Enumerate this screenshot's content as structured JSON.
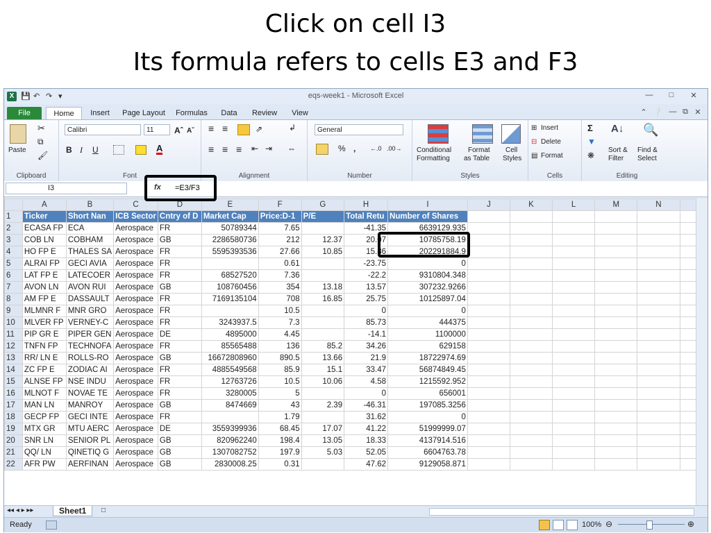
{
  "slide": {
    "title_line1": "Click on cell I3",
    "title_line2": "Its formula refers to cells E3 and F3"
  },
  "window": {
    "title": "eqs-week1 - Microsoft Excel"
  },
  "tabs": [
    "File",
    "Home",
    "Insert",
    "Page Layout",
    "Formulas",
    "Data",
    "Review",
    "View"
  ],
  "ribbon": {
    "clipboard": {
      "paste": "Paste",
      "label": "Clipboard"
    },
    "font": {
      "name": "Calibri",
      "size": "11",
      "label": "Font"
    },
    "alignment": {
      "label": "Alignment"
    },
    "number": {
      "format": "General",
      "percent": "%",
      "comma": ",",
      "label": "Number"
    },
    "styles": {
      "conditional": "Conditional",
      "conditional2": "Formatting",
      "format_table": "Format",
      "format_table2": "as Table",
      "cell_styles": "Cell",
      "cell_styles2": "Styles",
      "label": "Styles"
    },
    "cells": {
      "insert": "Insert",
      "delete": "Delete",
      "format": "Format",
      "label": "Cells"
    },
    "editing": {
      "sort": "Sort &",
      "sort2": "Filter",
      "find": "Find &",
      "find2": "Select",
      "label": "Editing"
    }
  },
  "formula_bar": {
    "name_box": "I3",
    "fx": "fx",
    "formula": "=E3/F3"
  },
  "columns": [
    "A",
    "B",
    "C",
    "D",
    "E",
    "F",
    "G",
    "H",
    "I",
    "J",
    "K",
    "L",
    "M",
    "N"
  ],
  "header_row": [
    "Ticker",
    "Short Nan",
    "ICB Sector",
    "Cntry of D",
    "Market Cap",
    "Price:D-1",
    "P/E",
    "Total Retu",
    "Number of Shares"
  ],
  "rows": [
    [
      "ECASA FP",
      "ECA",
      "Aerospace",
      "FR",
      "50789344",
      "7.65",
      "",
      "-41.35",
      "6639129.935"
    ],
    [
      "COB LN",
      "COBHAM",
      "Aerospace",
      "GB",
      "2286580736",
      "212",
      "12.37",
      "20.07",
      "10785758.19"
    ],
    [
      "HO FP E",
      "THALES SA",
      "Aerospace",
      "FR",
      "5595393536",
      "27.66",
      "10.85",
      "15.86",
      "202291884.9"
    ],
    [
      "ALRAI FP",
      "GECI AVIA",
      "Aerospace",
      "FR",
      "",
      "0.61",
      "",
      "-23.75",
      "0"
    ],
    [
      "LAT FP E",
      "LATECOER",
      "Aerospace",
      "FR",
      "68527520",
      "7.36",
      "",
      "-22.2",
      "9310804.348"
    ],
    [
      "AVON LN",
      "AVON RUI",
      "Aerospace",
      "GB",
      "108760456",
      "354",
      "13.18",
      "13.57",
      "307232.9266"
    ],
    [
      "AM FP E",
      "DASSAULT",
      "Aerospace",
      "FR",
      "7169135104",
      "708",
      "16.85",
      "25.75",
      "10125897.04"
    ],
    [
      "MLMNR F",
      "MNR GRO",
      "Aerospace",
      "FR",
      "",
      "10.5",
      "",
      "0",
      "0"
    ],
    [
      "MLVER FP",
      "VERNEY-C",
      "Aerospace",
      "FR",
      "3243937.5",
      "7.3",
      "",
      "85.73",
      "444375"
    ],
    [
      "PIP GR E",
      "PIPER GEN",
      "Aerospace",
      "DE",
      "4895000",
      "4.45",
      "",
      "-14.1",
      "1100000"
    ],
    [
      "TNFN FP",
      "TECHNOFA",
      "Aerospace",
      "FR",
      "85565488",
      "136",
      "85.2",
      "34.26",
      "629158"
    ],
    [
      "RR/ LN E",
      "ROLLS-RO",
      "Aerospace",
      "GB",
      "16672808960",
      "890.5",
      "13.66",
      "21.9",
      "18722974.69"
    ],
    [
      "ZC FP E",
      "ZODIAC AI",
      "Aerospace",
      "FR",
      "4885549568",
      "85.9",
      "15.1",
      "33.47",
      "56874849.45"
    ],
    [
      "ALNSE FP",
      "NSE INDU",
      "Aerospace",
      "FR",
      "12763726",
      "10.5",
      "10.06",
      "4.58",
      "1215592.952"
    ],
    [
      "MLNOT F",
      "NOVAE TE",
      "Aerospace",
      "FR",
      "3280005",
      "5",
      "",
      "0",
      "656001"
    ],
    [
      "MAN LN",
      "MANROY",
      "Aerospace",
      "GB",
      "8474669",
      "43",
      "2.39",
      "-46.31",
      "197085.3256"
    ],
    [
      "GECP FP",
      "GECI INTE",
      "Aerospace",
      "FR",
      "",
      "1.79",
      "",
      "31.62",
      "0"
    ],
    [
      "MTX GR",
      "MTU AERC",
      "Aerospace",
      "DE",
      "3559399936",
      "68.45",
      "17.07",
      "41.22",
      "51999999.07"
    ],
    [
      "SNR LN",
      "SENIOR PL",
      "Aerospace",
      "GB",
      "820962240",
      "198.4",
      "13.05",
      "18.33",
      "4137914.516"
    ],
    [
      "QQ/ LN",
      "QINETIQ G",
      "Aerospace",
      "GB",
      "1307082752",
      "197.9",
      "5.03",
      "52.05",
      "6604763.78"
    ],
    [
      "AFR PW",
      "AERFINAN",
      "Aerospace",
      "GB",
      "2830008.25",
      "0.31",
      "",
      "47.62",
      "9129058.871"
    ]
  ],
  "sheet_tab": "Sheet1",
  "status": {
    "ready": "Ready",
    "zoom": "100%"
  }
}
